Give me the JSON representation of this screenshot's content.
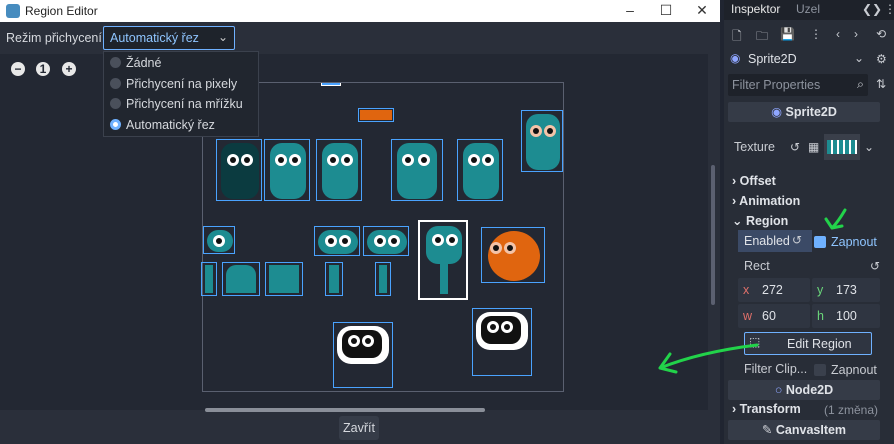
{
  "window": {
    "title": "Region Editor",
    "controls": {
      "minimize": "–",
      "maximize": "☐",
      "close": "✕"
    }
  },
  "toolbar": {
    "snap_label": "Režim přichycení:",
    "snap_value": "Automatický řez"
  },
  "zoom": {
    "out": "−",
    "reset": "1",
    "in": "+"
  },
  "snap_options": [
    {
      "label": "Žádné",
      "selected": false
    },
    {
      "label": "Přichycení na pixely",
      "selected": false
    },
    {
      "label": "Přichycení na mřížku",
      "selected": false
    },
    {
      "label": "Automatický řez",
      "selected": true
    }
  ],
  "footer": {
    "close_label": "Zavřít"
  },
  "inspector": {
    "tabs": [
      "Inspektor",
      "Uzel"
    ],
    "node_type": "Sprite2D",
    "filter_placeholder": "Filter Properties",
    "section_sprite": "Sprite2D",
    "texture_label": "Texture",
    "groups": {
      "offset": "Offset",
      "animation": "Animation",
      "region": "Region"
    },
    "enabled_label": "Enabled",
    "enabled_value": "Zapnout",
    "rect_label": "Rect",
    "rect": {
      "x": "272",
      "y": "173",
      "w": "60",
      "h": "100"
    },
    "edit_region_label": "Edit Region",
    "filter_clip_label": "Filter Clip...",
    "filter_clip_value": "Zapnout",
    "section_node2d": "Node2D",
    "transform_label": "Transform",
    "transform_changes": "(1 změna)",
    "section_canvasitem": "CanvasItem"
  },
  "colors": {
    "accent": "#6fb1ff",
    "selection": "#4aa3ff",
    "annotation": "#22d34a",
    "sprite_teal": "#1d8c91",
    "sprite_orange": "#e0650f"
  }
}
